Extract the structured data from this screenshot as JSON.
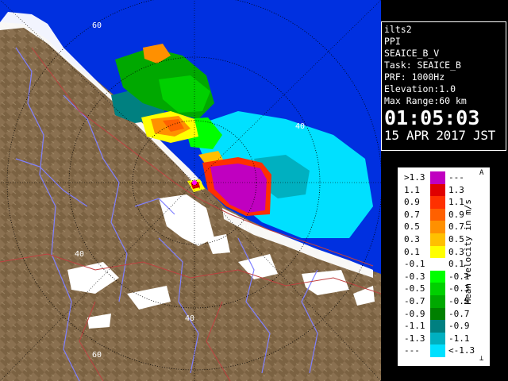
{
  "info": {
    "site": "ilts2",
    "product": "PPI",
    "parameter": "SEAICE_B_V",
    "task": "Task: SEAICE_B",
    "prf": "PRF: 1000Hz",
    "elevation": "Elevation:1.0",
    "max_range": "Max Range:60 km",
    "time": "01:05:03",
    "date": "15 APR 2017 JST"
  },
  "legend": {
    "title": "Mean Velocity in m/s",
    "top_mark": "A",
    "bottom_mark": "⊥",
    "rows": [
      {
        "label": ">1.3",
        "value": "---",
        "color": "#c000c0"
      },
      {
        "label": "1.1",
        "value": "1.3",
        "color": "#e00000"
      },
      {
        "label": "0.9",
        "value": "1.1",
        "color": "#ff3000"
      },
      {
        "label": "0.7",
        "value": "0.9",
        "color": "#ff6000"
      },
      {
        "label": "0.5",
        "value": "0.7",
        "color": "#ff9000"
      },
      {
        "label": "0.3",
        "value": "0.5",
        "color": "#ffc000"
      },
      {
        "label": "0.1",
        "value": "0.3",
        "color": "#ffff00"
      },
      {
        "label": "-0.1",
        "value": "0.1",
        "color": "#ffffff"
      },
      {
        "label": "-0.3",
        "value": "-0.1",
        "color": "#00ff00"
      },
      {
        "label": "-0.5",
        "value": "-0.3",
        "color": "#00d000"
      },
      {
        "label": "-0.7",
        "value": "-0.5",
        "color": "#00a800"
      },
      {
        "label": "-0.9",
        "value": "-0.7",
        "color": "#008000"
      },
      {
        "label": "-1.1",
        "value": "-0.9",
        "color": "#008080"
      },
      {
        "label": "-1.3",
        "value": "-1.1",
        "color": "#00b0c0"
      },
      {
        "label": "---",
        "value": "<-1.3",
        "color": "#00e0ff"
      }
    ]
  },
  "map": {
    "ring_labels": [
      "60",
      "40",
      "40",
      "40",
      "40",
      "60"
    ],
    "colors": {
      "sea": "#0030e0",
      "land": "#8a7050",
      "snow": "#ffffff",
      "river": "#8080ff",
      "road": "#c04040",
      "ring": "#000000"
    }
  }
}
